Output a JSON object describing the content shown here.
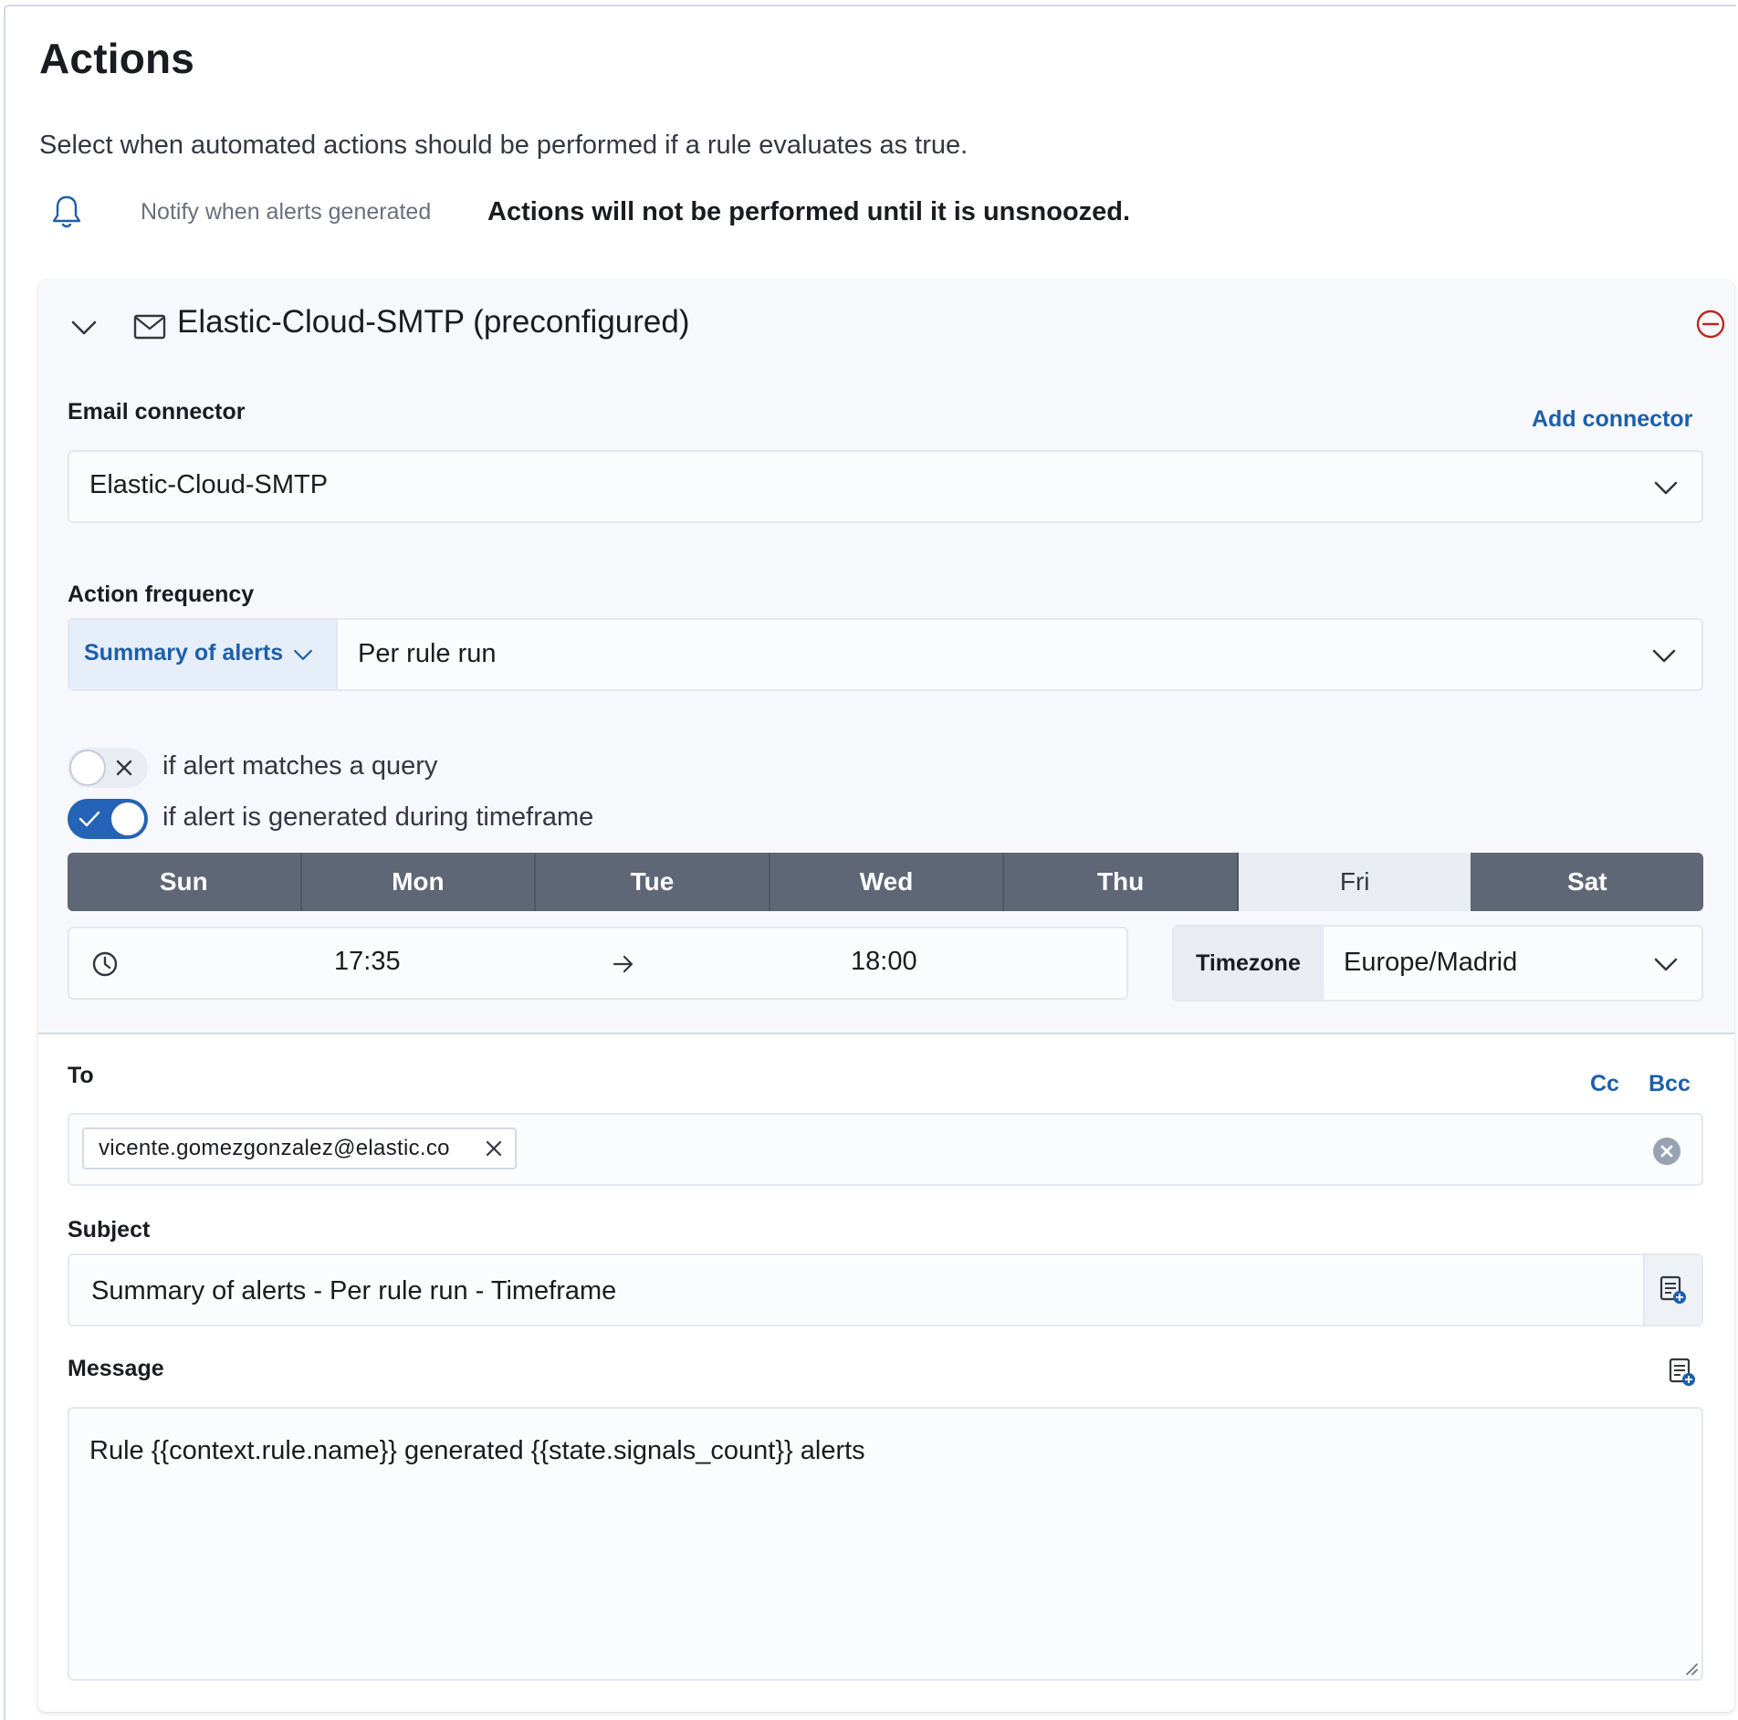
{
  "header": {
    "title": "Actions",
    "description": "Select when automated actions should be performed if a rule evaluates as true."
  },
  "notify": {
    "icon": "bell-icon",
    "label": "Notify when alerts generated",
    "snooze_note": "Actions will not be performed until it is unsnoozed."
  },
  "action": {
    "title": "Elastic-Cloud-SMTP (preconfigured)",
    "email_connector": {
      "label": "Email connector",
      "add_link": "Add connector",
      "value": "Elastic-Cloud-SMTP"
    },
    "frequency": {
      "label": "Action frequency",
      "type": "Summary of alerts",
      "value": "Per rule run"
    },
    "toggles": [
      {
        "label": "if alert matches a query",
        "on": false
      },
      {
        "label": "if alert is generated during timeframe",
        "on": true
      }
    ],
    "days": [
      {
        "label": "Sun",
        "selected": true
      },
      {
        "label": "Mon",
        "selected": true
      },
      {
        "label": "Tue",
        "selected": true
      },
      {
        "label": "Wed",
        "selected": true
      },
      {
        "label": "Thu",
        "selected": true
      },
      {
        "label": "Fri",
        "selected": false
      },
      {
        "label": "Sat",
        "selected": true
      }
    ],
    "timeframe": {
      "start": "17:35",
      "end": "18:00"
    },
    "timezone": {
      "label": "Timezone",
      "value": "Europe/Madrid"
    },
    "to": {
      "label": "To",
      "cc_link": "Cc",
      "bcc_link": "Bcc",
      "recipients": [
        "vicente.gomezgonzalez@elastic.co"
      ]
    },
    "subject": {
      "label": "Subject",
      "value": "Summary of alerts - Per rule run - Timeframe"
    },
    "message": {
      "label": "Message",
      "value": "Rule {{context.rule.name}} generated {{state.signals_count}} alerts"
    }
  },
  "colors": {
    "accent": "#1d5fab",
    "toggle_on": "#2563b6",
    "day_selected": "#5f6675",
    "danger": "#bd271e"
  }
}
